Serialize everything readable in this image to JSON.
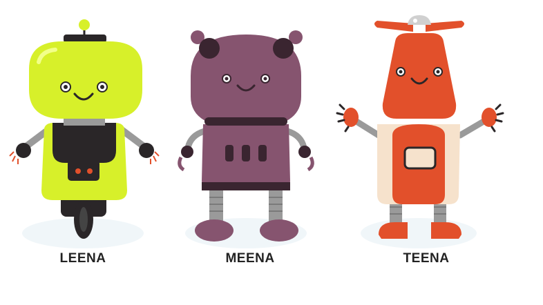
{
  "robots": [
    {
      "name": "LEENA",
      "icon": "yellow-wheel-robot-icon",
      "colors": {
        "head": "#d7f02a",
        "body": "#2a2628"
      }
    },
    {
      "name": "MEENA",
      "icon": "purple-round-robot-icon",
      "colors": {
        "head": "#86546f",
        "dark": "#3a2530"
      }
    },
    {
      "name": "TEENA",
      "icon": "orange-propeller-robot-icon",
      "colors": {
        "head": "#e2502b",
        "belly": "#f6e2cc"
      }
    }
  ]
}
